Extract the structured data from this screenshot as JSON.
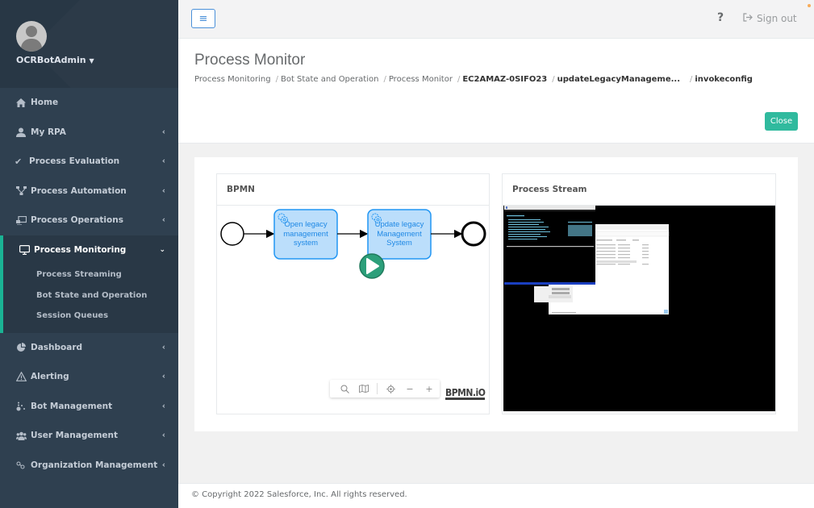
{
  "user": {
    "name": "OCRBotAdmin"
  },
  "sidebar": {
    "items": [
      {
        "label": "Home",
        "icon": "home-icon",
        "has_arrow": false
      },
      {
        "label": "My RPA",
        "icon": "user-icon",
        "has_arrow": true
      },
      {
        "label": "Process Evaluation",
        "icon": "check-icon",
        "has_arrow": true
      },
      {
        "label": "Process Automation",
        "icon": "sitemap-icon",
        "has_arrow": true
      },
      {
        "label": "Process Operations",
        "icon": "operations-icon",
        "has_arrow": true
      },
      {
        "label": "Process Monitoring",
        "icon": "monitor-icon",
        "has_arrow": true,
        "expanded": true
      },
      {
        "label": "Dashboard",
        "icon": "pie-chart-icon",
        "has_arrow": true
      },
      {
        "label": "Alerting",
        "icon": "warning-icon",
        "has_arrow": true
      },
      {
        "label": "Bot Management",
        "icon": "bot-icon",
        "has_arrow": true
      },
      {
        "label": "User Management",
        "icon": "users-icon",
        "has_arrow": true
      },
      {
        "label": "Organization Management",
        "icon": "link-icon",
        "has_arrow": true
      }
    ],
    "sub_items": [
      {
        "label": "Process Streaming"
      },
      {
        "label": "Bot State and Operation"
      },
      {
        "label": "Session Queues"
      }
    ]
  },
  "topbar": {
    "menu_icon": "≡",
    "help_label": "?",
    "signout_label": "Sign out"
  },
  "page": {
    "title": "Process Monitor",
    "breadcrumb": [
      {
        "label": "Process Monitoring",
        "bold": false
      },
      {
        "label": "Bot State and Operation",
        "bold": false
      },
      {
        "label": "Process Monitor",
        "bold": false
      },
      {
        "label": "EC2AMAZ-0SIFO23",
        "bold": true
      },
      {
        "label": "updateLegacyManageme...",
        "bold": true
      },
      {
        "label": "invokeconfig",
        "bold": true
      }
    ],
    "close_label": "Close"
  },
  "bpmn_panel": {
    "title": "BPMN",
    "tasks": [
      {
        "lines": [
          "Open legacy",
          "management",
          "system"
        ]
      },
      {
        "lines": [
          "Update legacy",
          "Management",
          "System"
        ],
        "active": true
      }
    ],
    "toolbar": [
      "search",
      "map",
      "center",
      "zoom-out",
      "zoom-in"
    ],
    "logo": "BPMN.iO"
  },
  "stream_panel": {
    "title": "Process Stream"
  },
  "colors": {
    "sidebar_bg": "#2f4050",
    "accent": "#1ab394",
    "task_fill": "#bbdefb",
    "task_stroke": "#2196f3",
    "link_blue": "#4a90d9"
  },
  "footer": {
    "text": "© Copyright 2022 Salesforce, Inc. All rights reserved."
  }
}
